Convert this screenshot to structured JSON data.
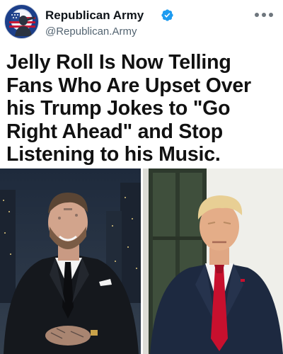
{
  "post": {
    "display_name": "Republican Army",
    "handle": "@Republican.Army",
    "verified": true,
    "avatar_icon": "patriot-flag-avatar-icon",
    "more_icon": "more-options-icon",
    "headline_lines": [
      "Jelly Roll Is Now Telling",
      "Fans Who Are Upset Over",
      "his Trump Jokes to \"Go",
      "Right Ahead\" and Stop",
      "Listening to his Music."
    ]
  },
  "media": {
    "left_photo": "bearded tattooed man in black suit on talk show set",
    "right_photo": "man in navy suit with red tie standing by window"
  },
  "colors": {
    "verified_blue": "#1d9bf0",
    "handle_gray": "#536471",
    "tie_red": "#c8102e"
  }
}
